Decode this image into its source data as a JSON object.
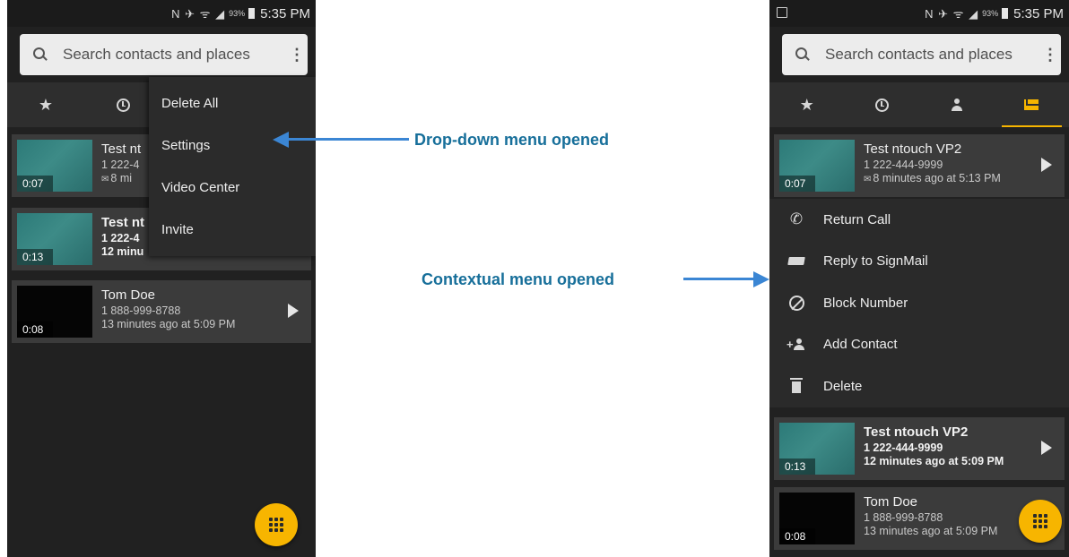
{
  "status_bar": {
    "icons": "N ✈ ᯤ ◢",
    "battery": "93%",
    "time": "5:35 PM"
  },
  "search": {
    "placeholder": "Search contacts and places",
    "more": "⋮"
  },
  "tabs": [
    {
      "icon": "star-icon",
      "glyph": "★"
    },
    {
      "icon": "history-icon"
    },
    {
      "icon": "contacts-icon"
    },
    {
      "icon": "signmail-icon"
    }
  ],
  "left_phone": {
    "dropdown": [
      "Delete All",
      "Settings",
      "Video Center",
      "Invite"
    ],
    "messages": [
      {
        "name": "Test nt",
        "number": "1 222-4",
        "time": "8 mi",
        "duration": "0:07",
        "unread": false
      },
      {
        "name": "Test nt",
        "number": "1 222-4",
        "time": "12 minu",
        "duration": "0:13",
        "unread": true
      },
      {
        "name": "Tom Doe",
        "number": "1 888-999-8788",
        "time": "13 minutes ago at 5:09 PM",
        "duration": "0:08",
        "unread": false
      }
    ]
  },
  "right_phone": {
    "messages": [
      {
        "name": "Test ntouch VP2",
        "number": "1 222-444-9999",
        "time": "8 minutes ago at 5:13 PM",
        "duration": "0:07",
        "unread": false
      },
      {
        "name": "Test ntouch VP2",
        "number": "1 222-444-9999",
        "time": "12 minutes ago at 5:09 PM",
        "duration": "0:13",
        "unread": true
      },
      {
        "name": "Tom Doe",
        "number": "1 888-999-8788",
        "time": "13 minutes ago at 5:09 PM",
        "duration": "0:08",
        "unread": false
      }
    ],
    "context_menu": [
      "Return Call",
      "Reply to SignMail",
      "Block Number",
      "Add Contact",
      "Delete"
    ]
  },
  "annotations": {
    "dropdown": "Drop-down menu opened",
    "contextual": "Contextual menu opened"
  },
  "colors": {
    "accent": "#f7b500",
    "annotation_text": "#176f9a",
    "arrow": "#3b86d4",
    "background": "#212121"
  }
}
